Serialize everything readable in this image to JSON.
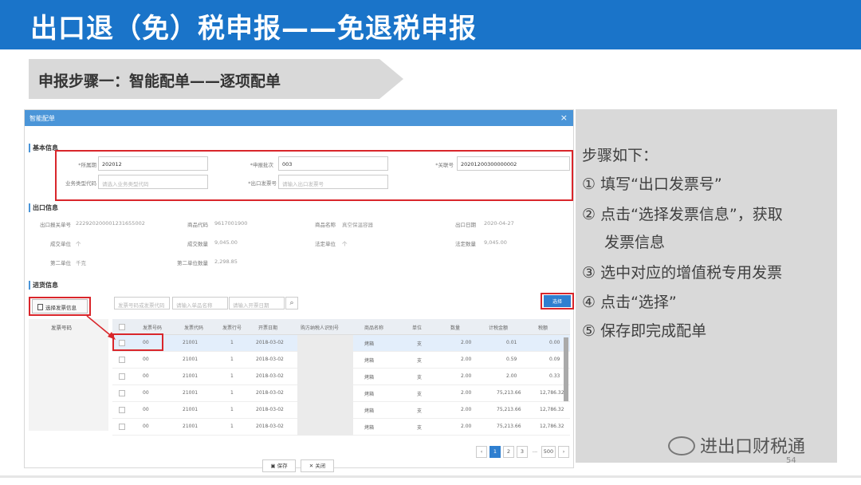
{
  "slide": {
    "title": "出口退（免）税申报——免退税申报",
    "step_banner": "申报步骤一：智能配单——逐项配单",
    "page_number": "54",
    "watermark": "进出口财税通"
  },
  "dialog": {
    "title": "智能配单",
    "close_icon": "×",
    "basic_section": "基本信息",
    "fields": {
      "period_label": "*所属期",
      "period_value": "202012",
      "batch_label": "*申报批次",
      "batch_value": "003",
      "customs_label": "*关联号",
      "customs_value": "20201200300000002",
      "biztype_label": "业务类型代码",
      "biztype_placeholder": "请选入业务类型代码",
      "invoice_no_label": "*出口发票号",
      "invoice_no_placeholder": "请输入出口发票号"
    },
    "export_section": "出口信息",
    "export_info": {
      "decl_no_label": "出口报关单号",
      "decl_no_value": "222920200001231655002",
      "goods_code_label": "商品代码",
      "goods_code_value": "9617001900",
      "goods_name_label": "商品名称",
      "goods_name_value": "真空保温容器",
      "export_date_label": "出口日期",
      "export_date_value": "2020-04-27",
      "deal_unit_label": "成交单位",
      "deal_unit_value": "个",
      "deal_qty_label": "成交数量",
      "deal_qty_value": "9,045.00",
      "legal_unit_label": "法定单位",
      "legal_unit_value": "个",
      "legal_qty_label": "法定数量",
      "legal_qty_value": "9,045.00",
      "second_unit_label": "第二单位",
      "second_unit_value": "千克",
      "second_qty_label": "第二单位数量",
      "second_qty_value": "2,298.85"
    },
    "purchase_section": "进货信息",
    "select_invoice_button": "选择发票信息",
    "search": {
      "ph1": "发票号码或发票代码",
      "ph2": "请输入单品名称",
      "ph3": "请输入开票日期"
    },
    "select_button": "选择",
    "left_col_header": "发票号码",
    "table": {
      "headers": [
        "发票号码",
        "发票代码",
        "发票行号",
        "开票日期",
        "购方纳税人识别号",
        "商品名称",
        "单位",
        "数量",
        "计税金额",
        "税额"
      ],
      "rows": [
        [
          "00",
          "21001",
          "1",
          "2018-03-02",
          "",
          "烤箱",
          "支",
          "2.00",
          "0.01",
          "0.00"
        ],
        [
          "00",
          "21001",
          "1",
          "2018-03-02",
          "",
          "烤箱",
          "支",
          "2.00",
          "0.59",
          "0.09"
        ],
        [
          "00",
          "21001",
          "1",
          "2018-03-02",
          "",
          "烤箱",
          "支",
          "2.00",
          "2.00",
          "0.33"
        ],
        [
          "00",
          "21001",
          "1",
          "2018-03-02",
          "",
          "烤箱",
          "支",
          "2.00",
          "75,213.66",
          "12,786.32"
        ],
        [
          "00",
          "21001",
          "1",
          "2018-03-02",
          "",
          "烤箱",
          "支",
          "2.00",
          "75,213.66",
          "12,786.32"
        ],
        [
          "00",
          "21001",
          "1",
          "2018-03-02",
          "",
          "烤箱",
          "支",
          "2.00",
          "75,213.66",
          "12,786.32"
        ]
      ]
    },
    "pager": [
      "‹",
      "1",
      "2",
      "3",
      "...",
      "500",
      "›"
    ],
    "save_button": "保存",
    "close_button": "关闭"
  },
  "steps": {
    "heading": "步骤如下：",
    "items": [
      "① 填写“出口发票号”",
      "② 点击“选择发票信息”，获取",
      "发票信息",
      "③ 选中对应的增值税专用发票",
      "④ 点击“选择”",
      "⑤ 保存即完成配单"
    ]
  },
  "colors": {
    "title_bar": "#1a74c9",
    "highlight_red": "#d9262b",
    "dialog_blue": "#4a95d8"
  }
}
